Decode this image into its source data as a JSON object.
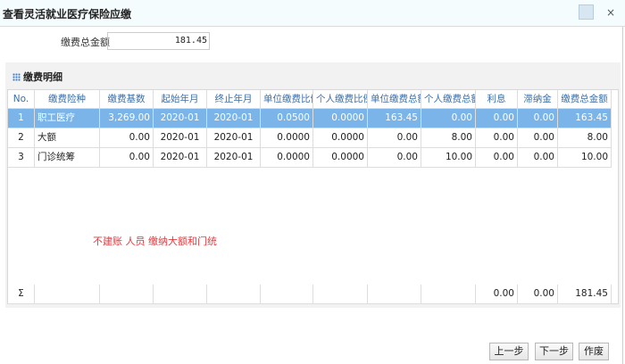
{
  "window": {
    "title": "查看灵活就业医疗保险应缴",
    "close_icon": "×"
  },
  "total": {
    "label": "缴费总金额",
    "value": "181.45"
  },
  "panel": {
    "title": "缴费明细"
  },
  "table": {
    "columns": [
      "No.",
      "缴费险种",
      "缴费基数",
      "起始年月",
      "终止年月",
      "单位缴费比例",
      "个人缴费比例",
      "单位缴费总额",
      "个人缴费总额",
      "利息",
      "滞纳金",
      "缴费总金额"
    ],
    "rows": [
      [
        "1",
        "职工医疗",
        "3,269.00",
        "2020-01",
        "2020-01",
        "0.0500",
        "0.0000",
        "163.45",
        "0.00",
        "0.00",
        "0.00",
        "163.45"
      ],
      [
        "2",
        "大额",
        "0.00",
        "2020-01",
        "2020-01",
        "0.0000",
        "0.0000",
        "0.00",
        "8.00",
        "0.00",
        "0.00",
        "8.00"
      ],
      [
        "3",
        "门诊统筹",
        "0.00",
        "2020-01",
        "2020-01",
        "0.0000",
        "0.0000",
        "0.00",
        "10.00",
        "0.00",
        "0.00",
        "10.00"
      ]
    ],
    "selected_row": 0,
    "summary": [
      "Σ",
      "",
      "",
      "",
      "",
      "",
      "",
      "",
      "",
      "0.00",
      "0.00",
      "181.45"
    ]
  },
  "note": "不建账 人员 缴纳大额和门统",
  "buttons": {
    "prev": "上一步",
    "next": "下一步",
    "void": "作废"
  }
}
